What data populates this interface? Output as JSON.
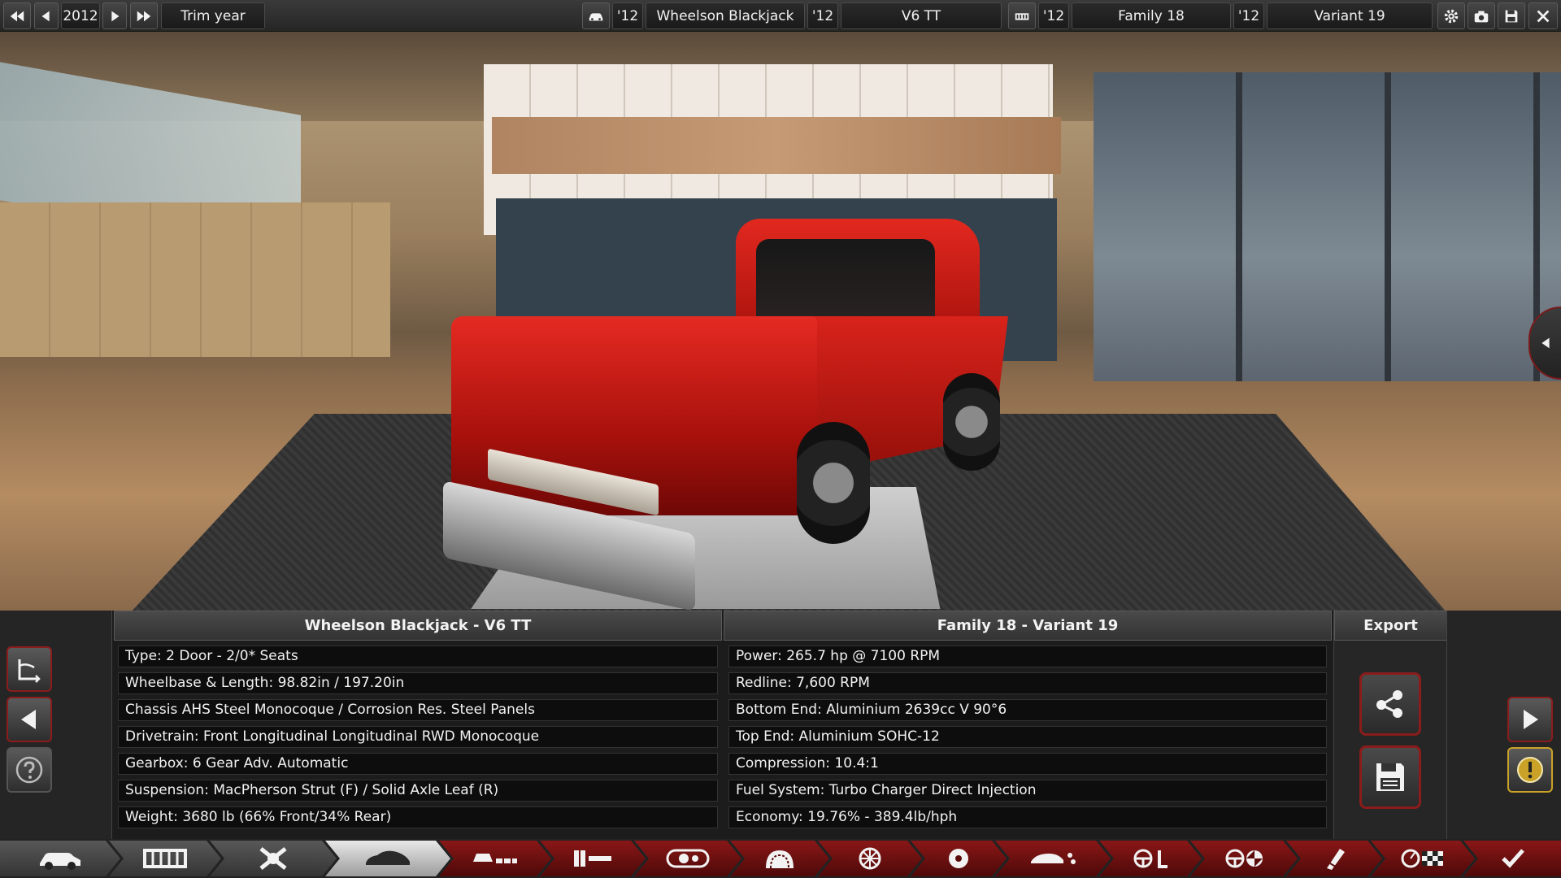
{
  "topbar": {
    "year": "2012",
    "trim_year_label": "Trim year",
    "model_year": "'12",
    "model_name": "Wheelson Blackjack",
    "trim_year": "'12",
    "trim_name": "V6 TT",
    "family_year": "'12",
    "family_name": "Family 18",
    "variant_year": "'12",
    "variant_name": "Variant 19"
  },
  "panel": {
    "car_header": "Wheelson Blackjack - V6 TT",
    "engine_header": "Family 18 - Variant 19",
    "export_header": "Export",
    "car_stats": [
      "Type: 2 Door - 2/0* Seats",
      "Wheelbase & Length: 98.82in / 197.20in",
      "Chassis AHS Steel Monocoque / Corrosion Res. Steel Panels",
      "Drivetrain: Front Longitudinal Longitudinal RWD Monocoque",
      "Gearbox: 6 Gear Adv. Automatic",
      "Suspension: MacPherson Strut (F) / Solid Axle Leaf (R)",
      "Weight: 3680 lb (66% Front/34% Rear)"
    ],
    "engine_stats": [
      "Power: 265.7 hp @ 7100 RPM",
      "Redline:  7,600 RPM",
      "Bottom End: Aluminium 2639cc V 90°6",
      "Top End: Aluminium SOHC-12",
      "Compression: 10.4:1",
      "Fuel System: Turbo Charger Direct Injection",
      "Economy: 19.76% - 389.4lb/hph"
    ]
  },
  "colors": {
    "accent_red": "#8b1c1c",
    "warning_gold": "#c9a227"
  },
  "bottom_nav": [
    "car-model-icon",
    "chassis-icon",
    "suspension-icon",
    "body-icon",
    "fixtures-icon",
    "trim-icon",
    "interior-icon",
    "tyres-icon",
    "wheels-icon",
    "brakes-icon",
    "aero-icon",
    "steering-icon",
    "drivetrain-icon",
    "tuning-icon",
    "testing-icon",
    "finish-icon"
  ]
}
